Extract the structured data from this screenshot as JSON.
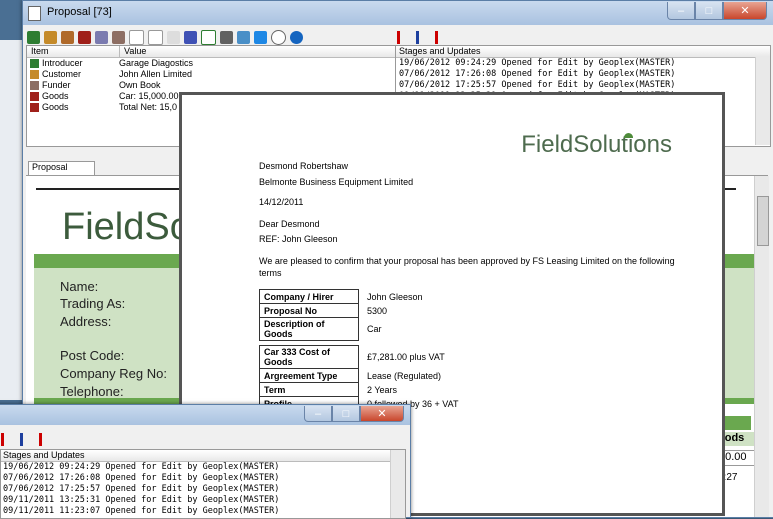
{
  "main_window": {
    "title": "Proposal [73]",
    "grid": {
      "headers": [
        "Item",
        "Value"
      ],
      "rows": [
        {
          "item": "Introducer",
          "value": "Garage Diagostics"
        },
        {
          "item": "Customer",
          "value": "John Allen Limited"
        },
        {
          "item": "Funder",
          "value": "Own Book"
        },
        {
          "item": "Goods",
          "value": "Car: 15,000.00"
        },
        {
          "item": "Goods",
          "value": "Total Net: 15,0"
        }
      ]
    },
    "stages": {
      "header": "Stages and Updates",
      "lines": [
        "19/06/2012 09:24:29 Opened for Edit by Geoplex(MASTER)",
        "07/06/2012 17:26:08 Opened for Edit by Geoplex(MASTER)",
        "07/06/2012 17:25:57 Opened for Edit by Geoplex(MASTER)",
        "09/11/2011 13:25:31 Opened for Edit by Geoplex(MASTER)"
      ]
    },
    "tab_label": "Proposal",
    "form": {
      "logo": "FieldSol",
      "labels": [
        "Name:",
        "Trading As:",
        "Address:",
        "Post Code:",
        "Company Reg No:",
        "Telephone:"
      ],
      "right_goods": "oods",
      "right_value": "00.00",
      "right_time": "9:27"
    }
  },
  "letter": {
    "logo_left": "FieldS",
    "logo_o": "o",
    "logo_right": "lutions",
    "recipient_name": "Desmond Robertshaw",
    "recipient_company": "Belmonte Business Equipment Limited",
    "date": "14/12/2011",
    "salutation": "Dear Desmond",
    "ref": "REF: John Gleeson",
    "body": "We are pleased to confirm that your proposal has been approved by FS Leasing Limited on the following terms",
    "table1": [
      {
        "k": "Company / Hirer",
        "v": "John Gleeson"
      },
      {
        "k": "Proposal No",
        "v": "5300"
      },
      {
        "k": "Description of Goods",
        "v": "Car"
      }
    ],
    "table2": [
      {
        "k": "Car 333 Cost of Goods",
        "v": "£7,281.00 plus VAT"
      },
      {
        "k": "Argreement Type",
        "v": "Lease (Regulated)"
      },
      {
        "k": "Term",
        "v": "2 Years"
      },
      {
        "k": "Profile",
        "v": "0 followed by 36 + VAT"
      }
    ]
  },
  "small_window": {
    "stages": {
      "header": "Stages and Updates",
      "lines": [
        "19/06/2012 09:24:29 Opened for Edit by Geoplex(MASTER)",
        "07/06/2012 17:26:08 Opened for Edit by Geoplex(MASTER)",
        "07/06/2012 17:25:57 Opened for Edit by Geoplex(MASTER)",
        "09/11/2011 13:25:31 Opened for Edit by Geoplex(MASTER)",
        "09/11/2011 11:23:07 Opened for Edit by Geoplex(MASTER)"
      ]
    }
  },
  "colors": {
    "green": "#6aa84f",
    "form_bg": "#cfe2c4",
    "accent": "#4a7f3a"
  }
}
